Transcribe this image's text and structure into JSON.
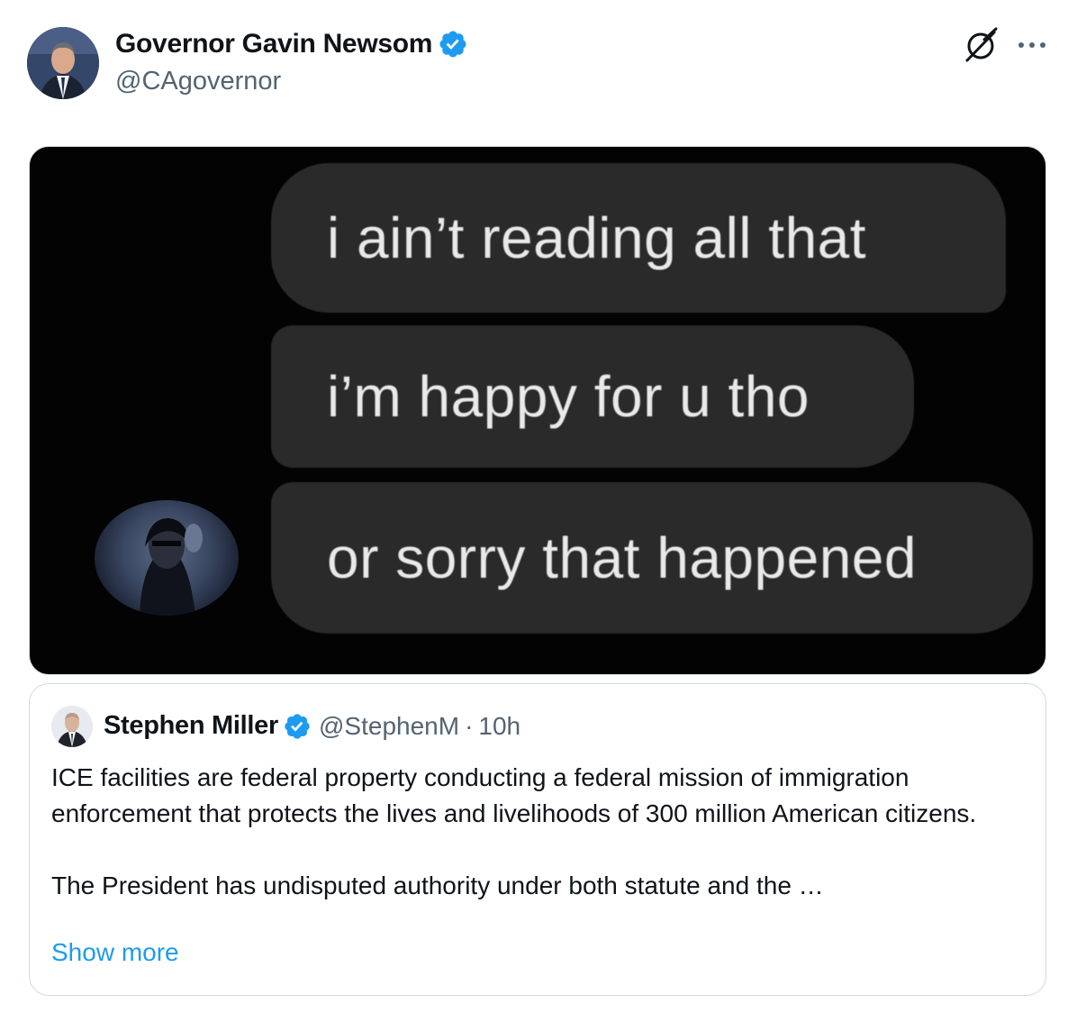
{
  "author": {
    "display_name": "Governor Gavin Newsom",
    "handle": "@CAgovernor",
    "verified_icon": "verified-badge-icon"
  },
  "header_actions": {
    "grok_icon": "grok-icon",
    "more_icon": "more-options-icon"
  },
  "media": {
    "bubbles": [
      "i ain’t reading all that",
      "i’m happy for u tho",
      "or sorry that happened"
    ]
  },
  "quoted_tweet": {
    "display_name": "Stephen Miller",
    "handle": "@StephenM",
    "separator": "·",
    "time": "10h",
    "paragraph_1": "ICE facilities are federal property conducting a federal mission of immigration enforcement that protects the lives and livelihoods of 300 million American citizens.",
    "paragraph_2": "The President has undisputed authority under both statute and the …",
    "show_more": "Show more"
  },
  "colors": {
    "verified_blue": "#1d9bf0",
    "link_blue": "#1d9bf0",
    "secondary_text": "#536471",
    "border": "#cfd9de",
    "bubble_bg": "#2a2a2b"
  }
}
